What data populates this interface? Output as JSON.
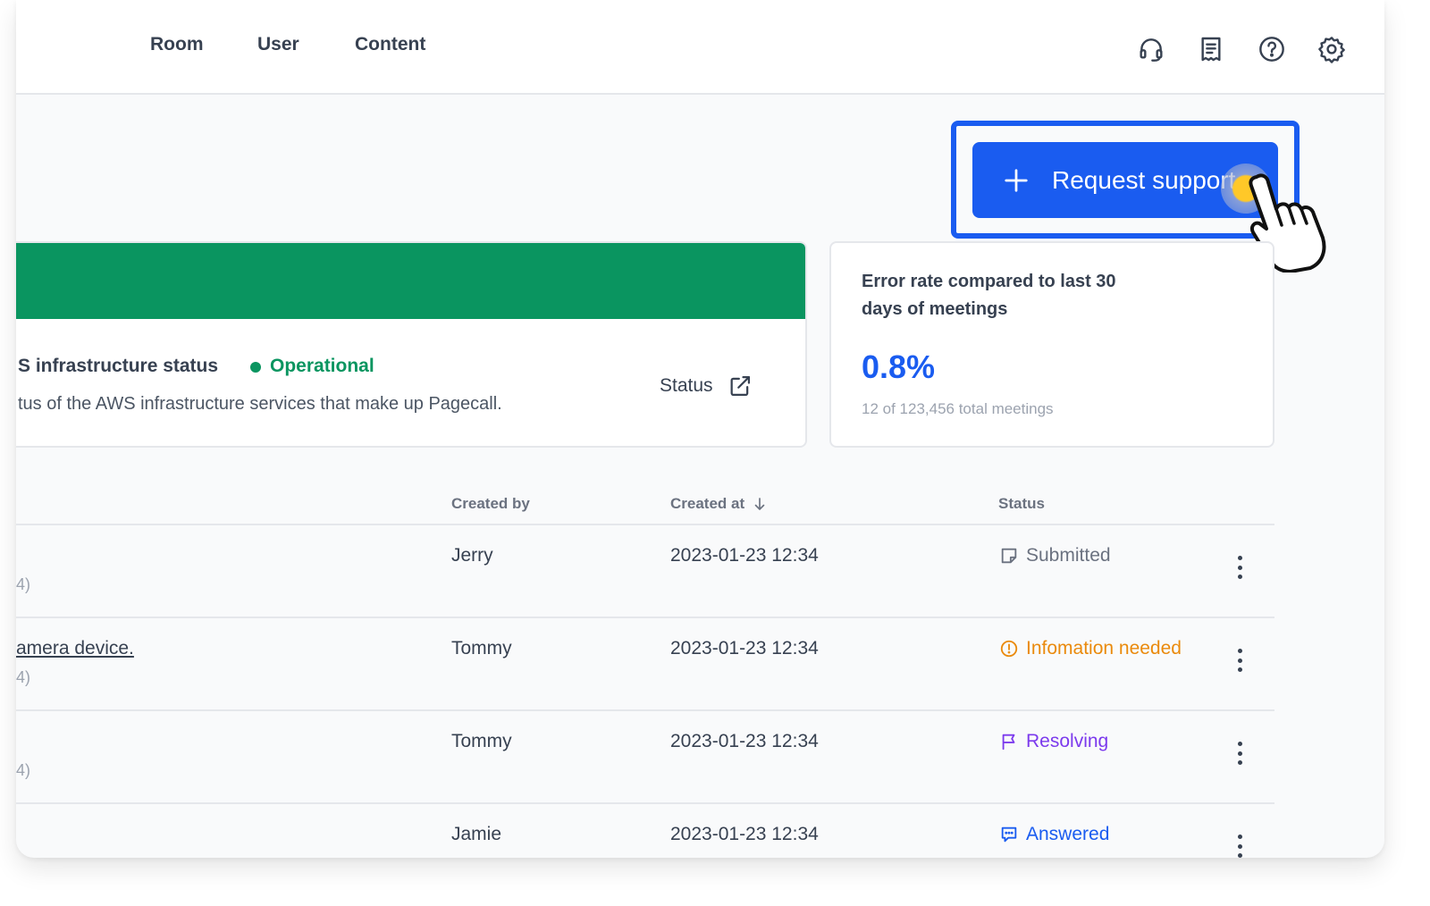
{
  "nav": {
    "items": [
      {
        "label": "Room"
      },
      {
        "label": "User"
      },
      {
        "label": "Content"
      }
    ],
    "icons": [
      "headset-icon",
      "receipt-icon",
      "help-icon",
      "settings-icon"
    ]
  },
  "action": {
    "request_support_label": "Request support",
    "icon": "plus-icon"
  },
  "infra": {
    "title": "S infrastructure status",
    "status": "Operational",
    "status_color": "#0a9560",
    "description": "tus of the AWS infrastructure services that make up Pagecall.",
    "link_label": "Status"
  },
  "error_rate": {
    "title": "Error rate compared to last 30 days of meetings",
    "value": "0.8%",
    "subtitle": "12 of 123,456 total meetings"
  },
  "table": {
    "headers": {
      "created_by": "Created by",
      "created_at": "Created at",
      "status": "Status"
    },
    "rows": [
      {
        "title": "",
        "sub": "4)",
        "created_by": "Jerry",
        "created_at": "2023-01-23 12:34",
        "status": "Submitted",
        "status_color": "#6b7280",
        "status_icon": "note-icon"
      },
      {
        "title": "amera device.",
        "sub": "4)",
        "created_by": "Tommy",
        "created_at": "2023-01-23 12:34",
        "status": "Infomation needed",
        "status_color": "#ea8a0c",
        "status_icon": "alert-circle-icon"
      },
      {
        "title": "",
        "sub": "4)",
        "created_by": "Tommy",
        "created_at": "2023-01-23 12:34",
        "status": "Resolving",
        "status_color": "#7c3aed",
        "status_icon": "flag-icon"
      },
      {
        "title": "",
        "sub": "",
        "created_by": "Jamie",
        "created_at": "2023-01-23 12:34",
        "status": "Answered",
        "status_color": "#1a5cf0",
        "status_icon": "chat-icon"
      }
    ]
  },
  "colors": {
    "accent": "#1a5cf0",
    "success": "#0a9560"
  }
}
